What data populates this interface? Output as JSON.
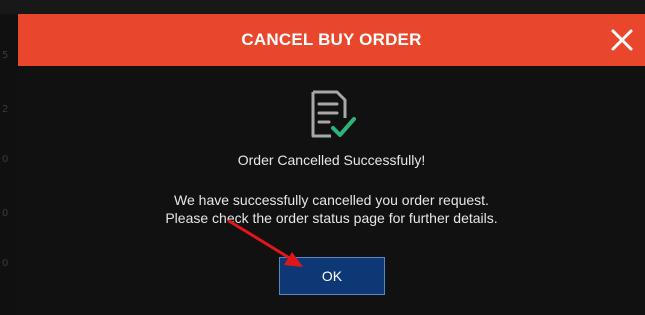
{
  "modal": {
    "title": "CANCEL BUY ORDER",
    "heading": "Order Cancelled Successfully!",
    "message_line1": "We have successfully cancelled you order request.",
    "message_line2": "Please check the order status page for further details.",
    "ok_label": "OK",
    "close_icon": "close-icon",
    "status_icon": "document-check-icon"
  },
  "colors": {
    "header": "#e8472c",
    "modal_bg": "#111111",
    "ok_button": "#0e3875",
    "check": "#2fb37a",
    "annotation_arrow": "#e0161b"
  }
}
